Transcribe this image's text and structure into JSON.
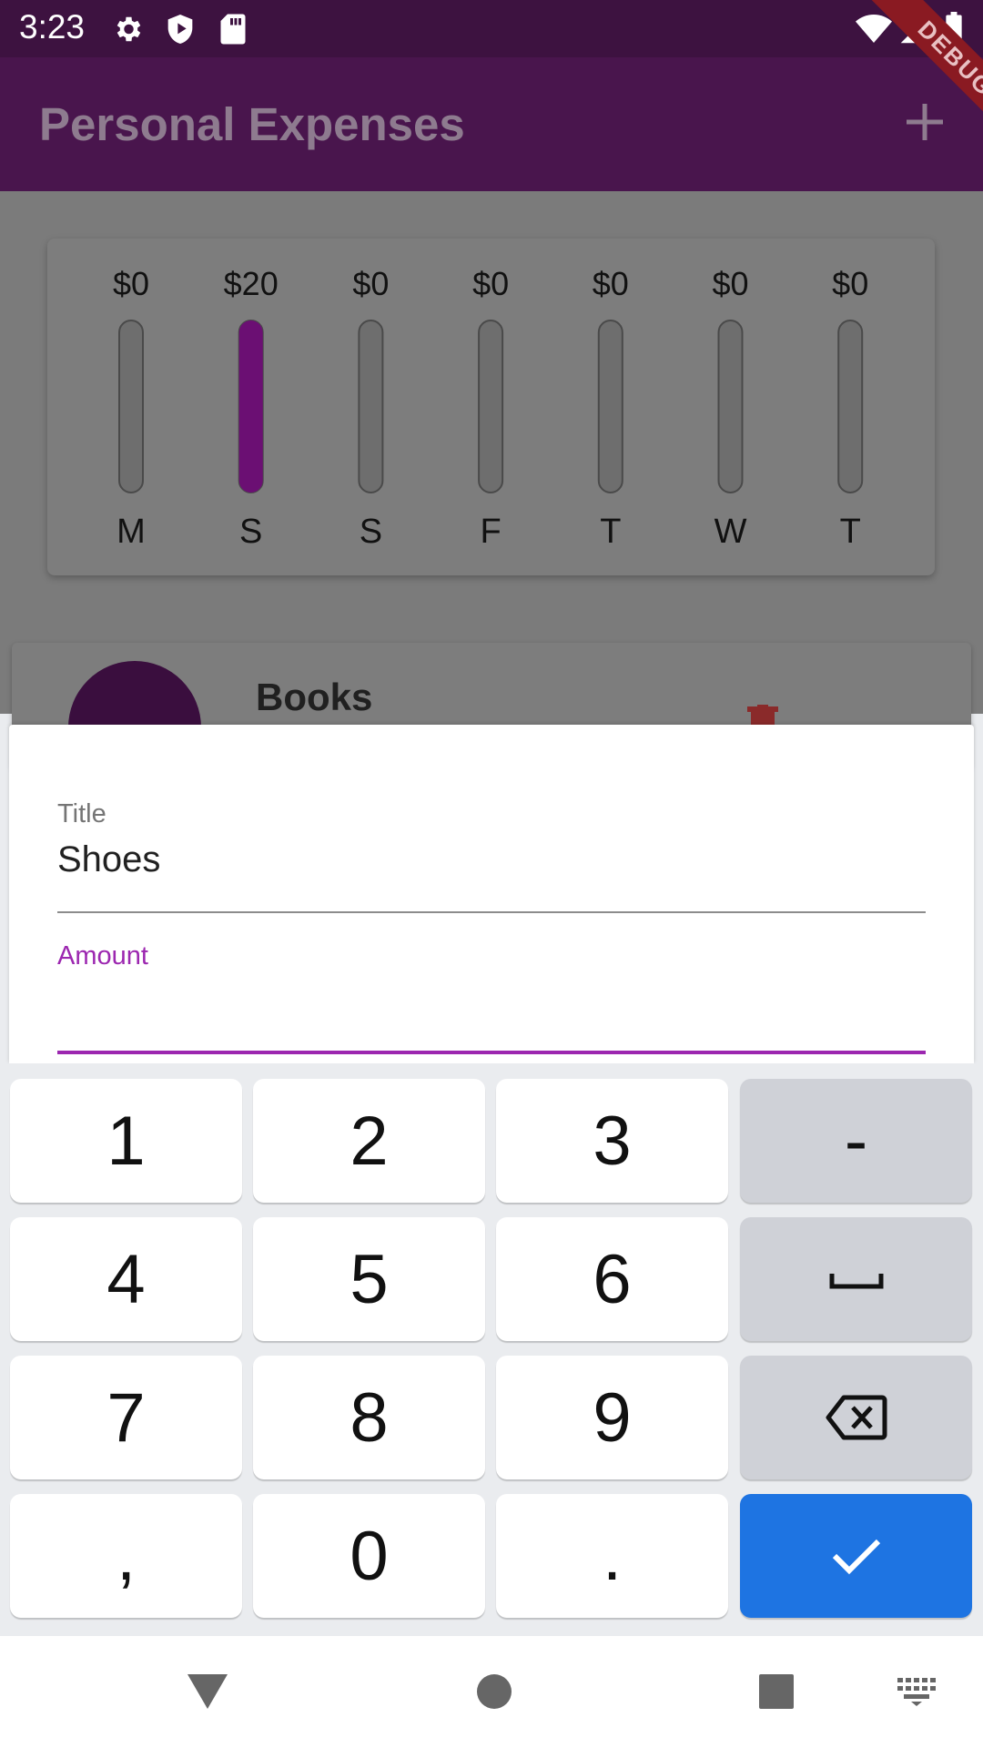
{
  "status_bar": {
    "time": "3:23",
    "left_icons": [
      "settings-icon",
      "play-protect-icon",
      "sd-card-icon"
    ],
    "right_icons": [
      "wifi-icon",
      "signal-icon",
      "battery-icon"
    ]
  },
  "debug_banner": {
    "label": "DEBUG"
  },
  "app_bar": {
    "title": "Personal Expenses",
    "action_icon": "plus-icon"
  },
  "chart_data": {
    "type": "bar",
    "categories": [
      "M",
      "S",
      "S",
      "F",
      "T",
      "W",
      "T"
    ],
    "value_labels": [
      "$0",
      "$20",
      "$0",
      "$0",
      "$0",
      "$0",
      "$0"
    ],
    "values": [
      0,
      20,
      0,
      0,
      0,
      0,
      0
    ],
    "fill_fraction": [
      0,
      1,
      0,
      0,
      0,
      0,
      0
    ],
    "bar_color": "#6b0f73",
    "track_color": "#6e6e6e"
  },
  "transaction": {
    "title": "Books",
    "delete_icon": "trash-icon"
  },
  "form": {
    "title_label": "Title",
    "title_value": "Shoes",
    "amount_label": "Amount",
    "amount_value": "",
    "accent_color": "#9c27b0"
  },
  "keyboard": {
    "keys": [
      "1",
      "2",
      "3",
      "-",
      "4",
      "5",
      "6",
      "space",
      "7",
      "8",
      "9",
      "backspace",
      ",",
      "0",
      ".",
      "enter"
    ],
    "labels": {
      "1": "1",
      "2": "2",
      "3": "3",
      "minus": "-",
      "4": "4",
      "5": "5",
      "6": "6",
      "7": "7",
      "8": "8",
      "9": "9",
      "comma": ",",
      "0": "0",
      "period": "."
    },
    "enter_color": "#1e74e2"
  },
  "nav_bar": {
    "icons": [
      "back-icon",
      "home-icon",
      "recents-icon",
      "keyboard-switch-icon"
    ]
  }
}
